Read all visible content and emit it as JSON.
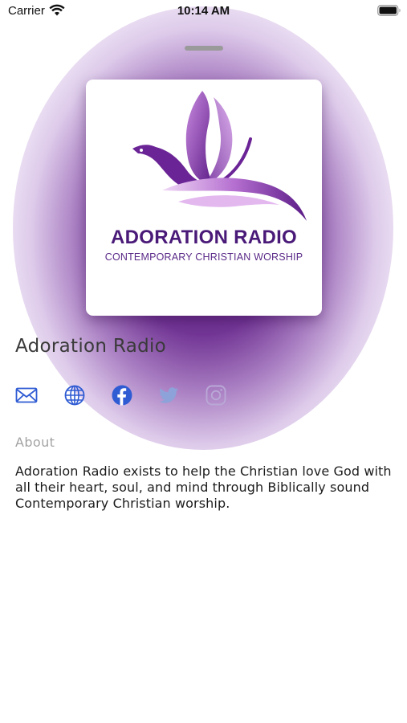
{
  "status_bar": {
    "carrier": "Carrier",
    "time": "10:14 AM",
    "wifi_icon": "wifi-icon",
    "battery_icon": "battery-icon"
  },
  "artwork": {
    "logo_title": "ADORATION RADIO",
    "logo_tagline": "CONTEMPORARY CHRISTIAN WORSHIP",
    "logo_color": "#5a1f86"
  },
  "station": {
    "name": "Adoration Radio"
  },
  "social": [
    {
      "icon": "mail-icon",
      "color": "#2f5bd3"
    },
    {
      "icon": "globe-icon",
      "color": "#2f5bd3"
    },
    {
      "icon": "facebook-icon",
      "color": "#2f5bd3"
    },
    {
      "icon": "twitter-icon",
      "color": "#8ea2da"
    },
    {
      "icon": "instagram-icon",
      "color": "#b9a8d6"
    }
  ],
  "about": {
    "label": "About",
    "text": "Adoration Radio exists to help the Christian love God with all their heart, soul, and mind through Biblically sound Contemporary Christian worship."
  },
  "colors": {
    "glow": "#5c1a86",
    "accent": "#2f5bd3"
  }
}
